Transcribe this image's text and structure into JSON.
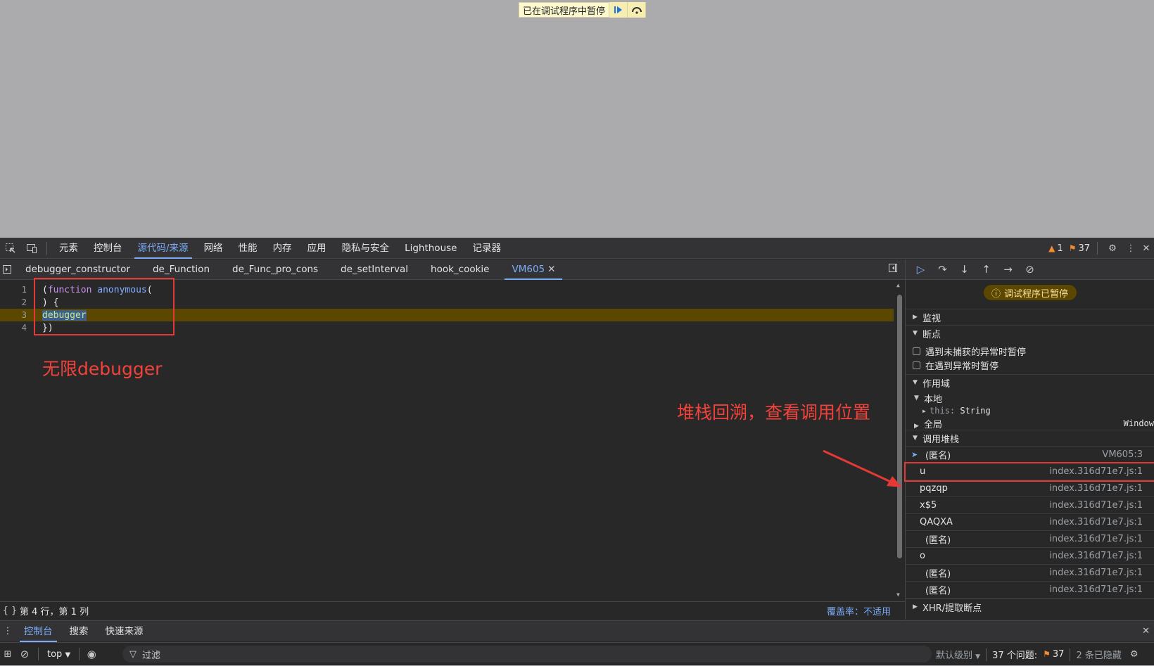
{
  "banner": {
    "text": "已在调试程序中暂停",
    "resume_icon": "resume-icon",
    "step_icon": "step-over-icon"
  },
  "devtools": {
    "panels": [
      "元素",
      "控制台",
      "源代码/来源",
      "网络",
      "性能",
      "内存",
      "应用",
      "隐私与安全",
      "Lighthouse",
      "记录器"
    ],
    "active_panel": "源代码/来源",
    "warnings": "1",
    "issues": "37"
  },
  "files": {
    "tabs": [
      "debugger_constructor",
      "de_Function",
      "de_Func_pro_cons",
      "de_setInterval",
      "hook_cookie",
      "VM605"
    ],
    "active": "VM605"
  },
  "code": {
    "lines": [
      {
        "n": "1",
        "parts": [
          [
            "p",
            "("
          ],
          [
            "kw",
            "function"
          ],
          [
            "p",
            " "
          ],
          [
            "fn",
            "anonymous"
          ],
          [
            "p",
            "("
          ]
        ]
      },
      {
        "n": "2",
        "parts": [
          [
            "p",
            ") {"
          ]
        ]
      },
      {
        "n": "3",
        "parts": [
          [
            "sel",
            "debugger"
          ]
        ]
      },
      {
        "n": "4",
        "parts": [
          [
            "p",
            "})"
          ]
        ]
      }
    ]
  },
  "annotations": {
    "left": "无限debugger",
    "right": "堆栈回溯，查看调用位置"
  },
  "status": {
    "position": "第 4 行，第 1 列",
    "coverage": "覆盖率：不适用"
  },
  "debugger": {
    "paused_label": "调试程序已暂停",
    "watch": "监视",
    "breakpoints": "断点",
    "pause_uncaught": "遇到未捕获的异常时暂停",
    "pause_caught": "在遇到异常时暂停",
    "scope": "作用域",
    "local": "本地",
    "this_key": "this",
    "this_val": "String",
    "global": "全局",
    "global_val": "Window",
    "callstack": "调用堆栈",
    "frames": [
      {
        "name": "(匿名)",
        "loc": "VM605:3"
      },
      {
        "name": "u",
        "loc": "index.316d71e7.js:1"
      },
      {
        "name": "pqzqp",
        "loc": "index.316d71e7.js:1"
      },
      {
        "name": "x$5",
        "loc": "index.316d71e7.js:1"
      },
      {
        "name": "QAQXA",
        "loc": "index.316d71e7.js:1"
      },
      {
        "name": "(匿名)",
        "loc": "index.316d71e7.js:1"
      },
      {
        "name": "o",
        "loc": "index.316d71e7.js:1"
      },
      {
        "name": "(匿名)",
        "loc": "index.316d71e7.js:1"
      },
      {
        "name": "(匿名)",
        "loc": "index.316d71e7.js:1"
      }
    ],
    "xhr": "XHR/提取断点"
  },
  "drawer": {
    "tabs": [
      "控制台",
      "搜索",
      "快速来源"
    ],
    "context": "top",
    "filter": "过滤",
    "level": "默认级别",
    "issues_label": "37 个问题:",
    "issues_count": "37",
    "hidden": "2 条已隐藏"
  }
}
